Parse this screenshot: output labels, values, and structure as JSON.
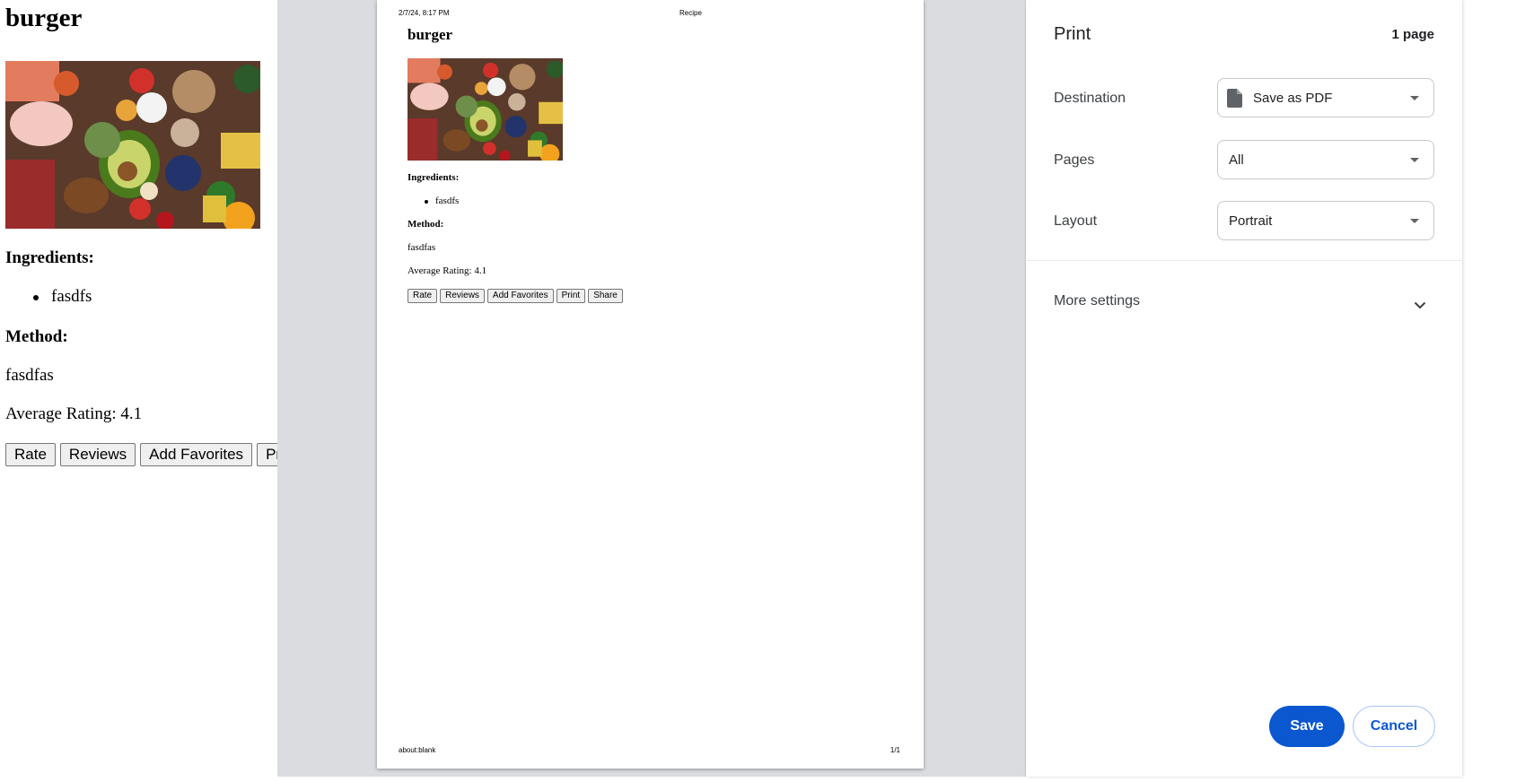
{
  "recipe": {
    "title": "burger",
    "ingredients_heading": "Ingredients:",
    "ingredients": [
      "fasdfs"
    ],
    "method_heading": "Method:",
    "method_text": "fasdfas",
    "rating_text": "Average Rating: 4.1",
    "buttons": {
      "rate": "Rate",
      "reviews": "Reviews",
      "add_favorites": "Add Favorites",
      "print": "Print",
      "share": "Share"
    }
  },
  "preview": {
    "header_date": "2/7/24, 8:17 PM",
    "header_title": "Recipe",
    "footer_url": "about:blank",
    "footer_page": "1/1"
  },
  "print_dialog": {
    "title": "Print",
    "page_count": "1 page",
    "destination_label": "Destination",
    "destination_value": "Save as PDF",
    "pages_label": "Pages",
    "pages_value": "All",
    "layout_label": "Layout",
    "layout_value": "Portrait",
    "more_settings": "More settings",
    "save_label": "Save",
    "cancel_label": "Cancel"
  },
  "colors": {
    "accent": "#0b57d0",
    "preview_background": "#dadce0"
  },
  "icons": [
    "document-icon",
    "chevron-down-icon",
    "dropdown-caret-icon"
  ]
}
